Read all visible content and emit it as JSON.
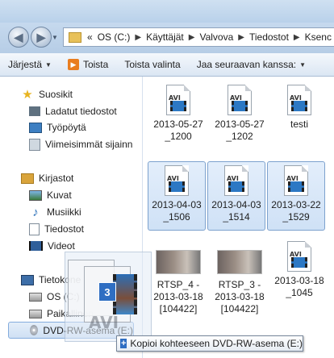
{
  "address": {
    "overflow": "«",
    "crumbs": [
      "OS (C:)",
      "Käyttäjät",
      "Valvova",
      "Tiedostot",
      "Ksenc"
    ]
  },
  "toolbar": {
    "organize": "Järjestä",
    "play": "Toista",
    "play_all": "Toista valinta",
    "share": "Jaa seuraavan kanssa:"
  },
  "nav": {
    "favorites": "Suosikit",
    "downloads": "Ladatut tiedostot",
    "desktop": "Työpöytä",
    "recent": "Viimeisimmät sijainn",
    "libraries": "Kirjastot",
    "pictures": "Kuvat",
    "music": "Musiikki",
    "documents": "Tiedostot",
    "videos": "Videot",
    "computer": "Tietokone",
    "os_drive": "OS (C:)",
    "local_drive": "Paikallinen",
    "dvd_drive": "DVD-RW-asema (E:)"
  },
  "files": [
    {
      "name": "2013-05-27\n_1200",
      "line1": "2013-05-27",
      "line2": "_1200"
    },
    {
      "name": "2013-05-27\n_1202",
      "line1": "2013-05-27",
      "line2": "_1202"
    },
    {
      "name": "testi",
      "line1": "testi",
      "line2": ""
    },
    {
      "name": "2013-04-03\n_1506",
      "line1": "2013-04-03",
      "line2": "_1506"
    },
    {
      "name": "2013-04-03\n_1514",
      "line1": "2013-04-03",
      "line2": "_1514"
    },
    {
      "name": "2013-03-22\n_1529",
      "line1": "2013-03-22",
      "line2": "_1529"
    },
    {
      "line1": "RTSP_4 -",
      "line2": "2013-03-18",
      "line3": "[104422]"
    },
    {
      "line1": "RTSP_3 -",
      "line2": "2013-03-18",
      "line3": "[104422]"
    },
    {
      "line1": "2013-03-18",
      "line2": "_1045",
      "line3": ""
    }
  ],
  "drag": {
    "count": "3",
    "ghost_label": "AVI",
    "tooltip": "Kopioi kohteeseen DVD-RW-asema (E:)"
  }
}
